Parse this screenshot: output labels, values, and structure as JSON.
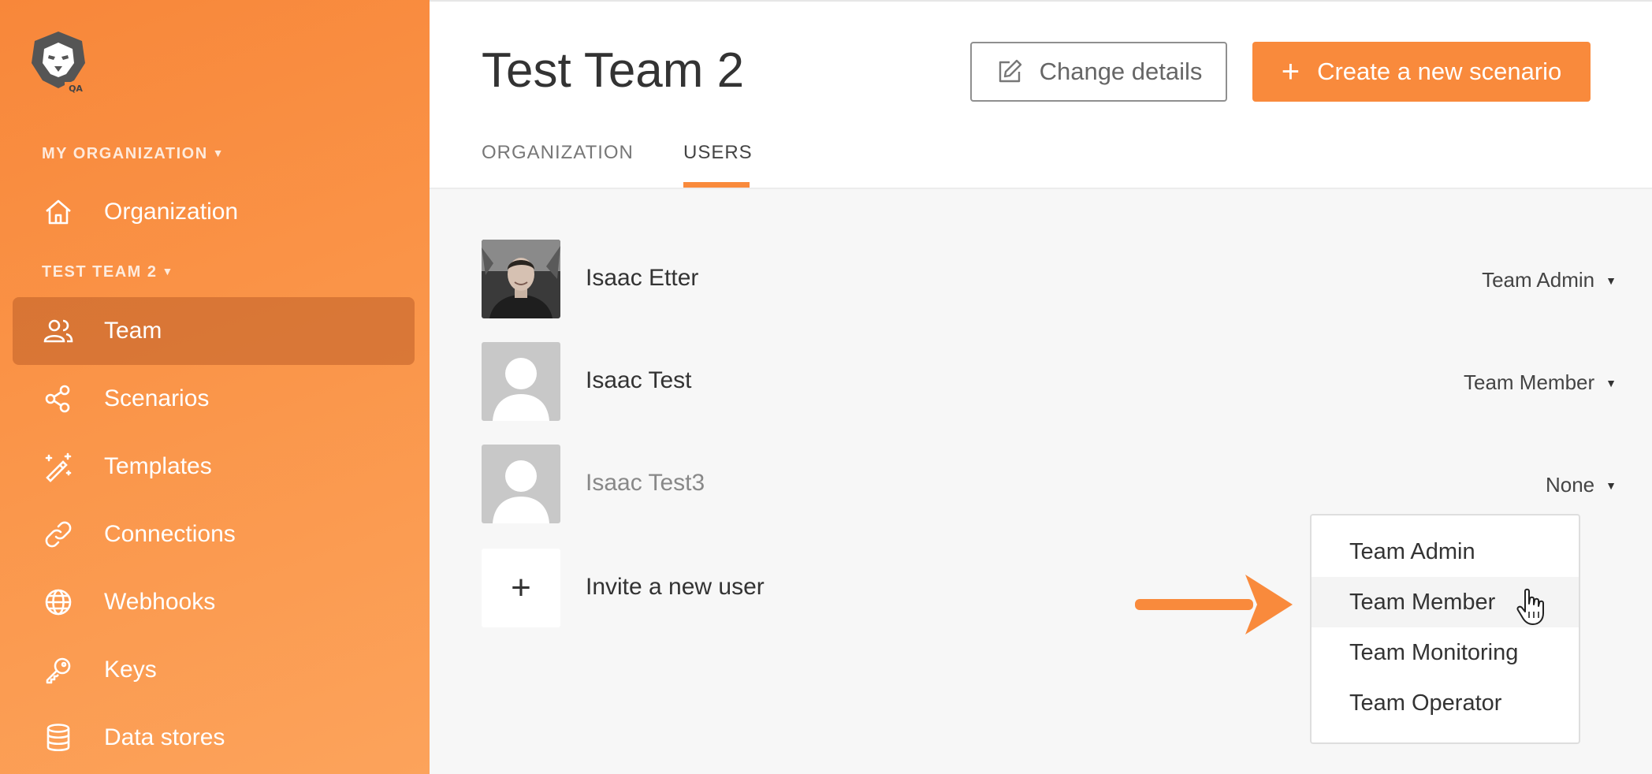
{
  "sidebar": {
    "org_section": "MY ORGANIZATION",
    "team_section": "TEST TEAM 2",
    "org_items": [
      {
        "label": "Organization",
        "icon": "home-icon"
      }
    ],
    "team_items": [
      {
        "label": "Team",
        "icon": "users-icon",
        "active": true
      },
      {
        "label": "Scenarios",
        "icon": "share-icon"
      },
      {
        "label": "Templates",
        "icon": "magic-wand-icon"
      },
      {
        "label": "Connections",
        "icon": "link-icon"
      },
      {
        "label": "Webhooks",
        "icon": "globe-icon"
      },
      {
        "label": "Keys",
        "icon": "key-icon"
      },
      {
        "label": "Data stores",
        "icon": "database-icon"
      }
    ]
  },
  "header": {
    "title": "Test Team 2",
    "change_details_label": "Change details",
    "create_scenario_label": "Create a new scenario",
    "tabs": [
      {
        "label": "ORGANIZATION",
        "active": false
      },
      {
        "label": "USERS",
        "active": true
      }
    ]
  },
  "users": [
    {
      "name": "Isaac Etter",
      "role": "Team Admin",
      "avatar": "photo"
    },
    {
      "name": "Isaac Test",
      "role": "Team Member",
      "avatar": "placeholder"
    },
    {
      "name": "Isaac Test3",
      "role": "None",
      "avatar": "placeholder"
    }
  ],
  "invite": {
    "label": "Invite a new user"
  },
  "role_menu": {
    "options": [
      "Team Admin",
      "Team Member",
      "Team Monitoring",
      "Team Operator"
    ],
    "hovered": "Team Member"
  },
  "colors": {
    "accent": "#f98a3c",
    "sidebar_start": "#f8873a",
    "sidebar_end": "#fca35b"
  }
}
